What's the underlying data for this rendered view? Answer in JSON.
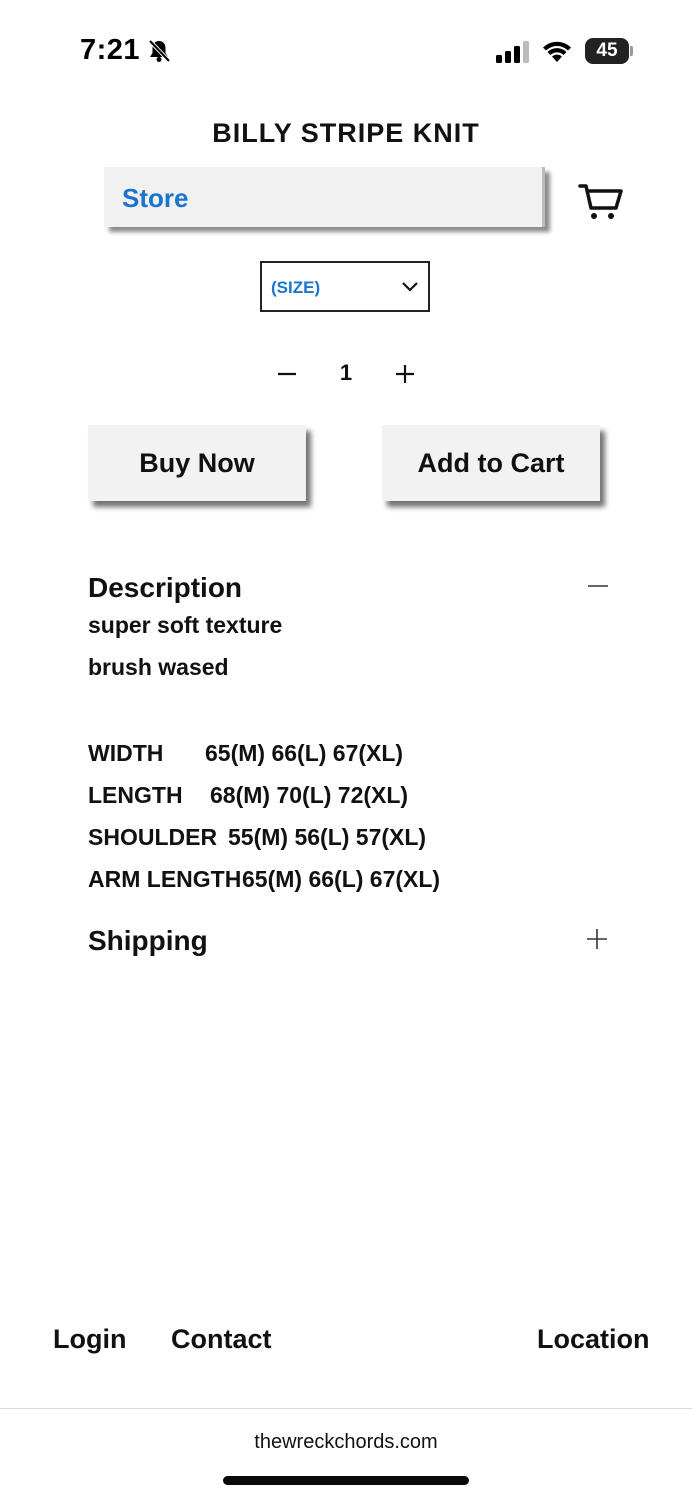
{
  "status_bar": {
    "time": "7:21",
    "battery": "45",
    "icons": [
      "bell-slash-icon",
      "cellular-signal-icon",
      "wifi-icon",
      "battery-icon"
    ]
  },
  "product": {
    "title": "BILLY STRIPE KNIT"
  },
  "nav": {
    "store_label": "Store",
    "cart_icon": "cart-icon"
  },
  "size_select": {
    "selected": "(SIZE)"
  },
  "quantity": {
    "value": "1"
  },
  "actions": {
    "buy_now": "Buy Now",
    "add_to_cart": "Add to Cart"
  },
  "description": {
    "heading": "Description",
    "lines": [
      "super soft texture",
      "brush wased"
    ],
    "specs": [
      {
        "label": "WIDTH",
        "value": "65(M) 66(L) 67(XL)"
      },
      {
        "label": "LENGTH",
        "value": "68(M) 70(L) 72(XL)"
      },
      {
        "label": "SHOULDER",
        "value": "55(M) 56(L) 57(XL)"
      },
      {
        "label": "ARM LENGTH",
        "value": "65(M) 66(L) 67(XL)"
      }
    ]
  },
  "shipping": {
    "heading": "Shipping"
  },
  "footer": {
    "login": "Login",
    "contact": "Contact",
    "location": "Location"
  },
  "browser": {
    "url": "thewreckchords.com"
  },
  "colors": {
    "accent_blue": "#1a74d0",
    "button_bg": "#f1f1f1"
  }
}
